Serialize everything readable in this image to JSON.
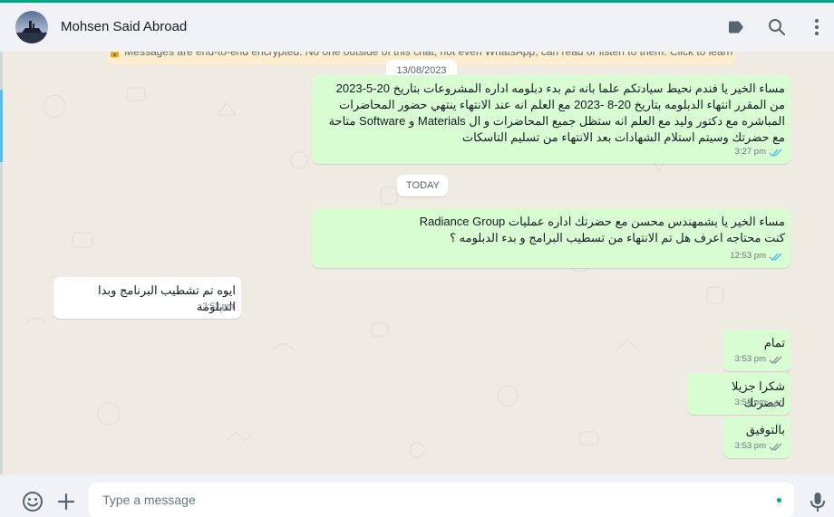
{
  "header": {
    "contact_name": "Mohsen Said Abroad",
    "icons": [
      "label-icon",
      "search-icon",
      "menu-icon"
    ]
  },
  "encryption_notice": "🔒 Messages are end-to-end encrypted. No one outside of this chat, not even WhatsApp, can read or listen to them. Click to learn more.",
  "date_chips": {
    "first": "13/08/2023",
    "today": "TODAY"
  },
  "messages": [
    {
      "direction": "out",
      "text": "مساء الخير يا فندم نحيط سيادتكم علما بانه تم  بدء دبلومه اداره المشروعات  بتاريخ 20-5-2023 من المقرر انتهاء الدبلومه  بتاريخ  20-8 -2023 مع العلم انه عند الانتهاء  ينتهي حضور المحاضرات المباشره مع دكتور وليد مع العلم انه ستظل جميع المحاضرات و ال Materials و Software متاحة مع حضرتك وسيتم استلام الشهادات بعد الانتهاء من تسليم التاسكات",
      "time": "3:27 pm",
      "status": "read"
    },
    {
      "direction": "out",
      "text": "مساء الخير يا بشمهندس محسن  مع حضرتك اداره عمليات Radiance Group\nكنت محتاجه اعرف هل تم الانتهاء من تسطيب البرامج و بدء الدبلومه ؟",
      "time": "12:53 pm",
      "status": "read"
    },
    {
      "direction": "in",
      "text": "ايوه تم تشطيب البرنامج وبدا الدبلومة",
      "time": "3:53 pm"
    },
    {
      "direction": "out",
      "text": "تمام",
      "time": "3:53 pm",
      "status": "sent"
    },
    {
      "direction": "out",
      "text": "شكرا جزيلا لحضرتك",
      "time": "3:53 pm",
      "status": "sent"
    },
    {
      "direction": "out",
      "text": "بالتوفيق",
      "time": "3:53 pm",
      "status": "sent"
    }
  ],
  "composer": {
    "placeholder": "Type a message",
    "icons": [
      "emoji-icon",
      "attach-plus-icon",
      "microphone-icon"
    ]
  },
  "colors": {
    "accent": "#00a884",
    "outgoing_bubble": "#d9fdd3",
    "incoming_bubble": "#ffffff",
    "read_ticks": "#53bdeb",
    "sent_ticks": "#8696a0",
    "chat_background": "#efeae2"
  }
}
